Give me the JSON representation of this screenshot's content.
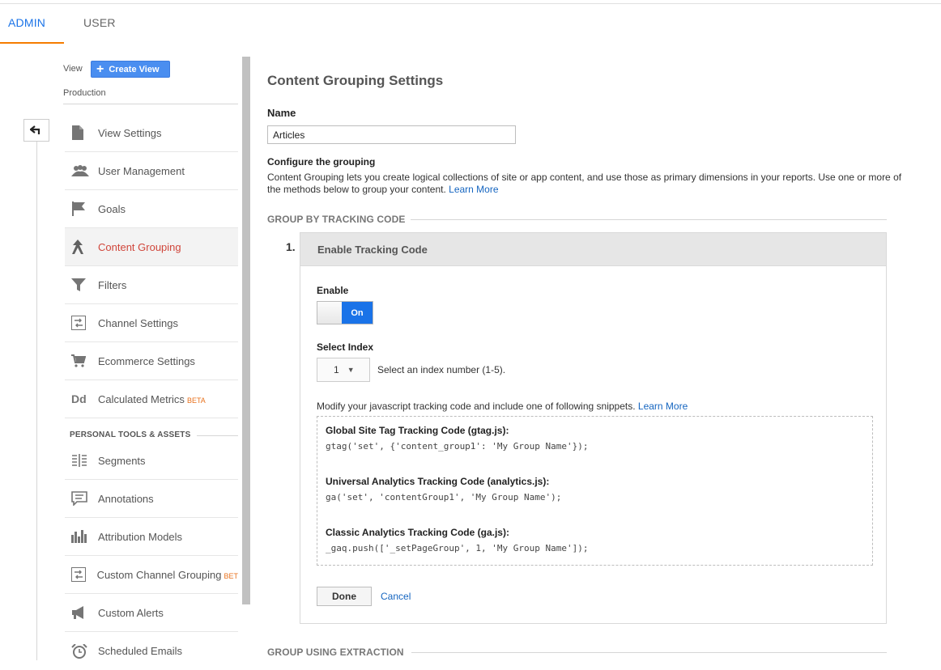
{
  "tabs": [
    {
      "label": "ADMIN",
      "active": true
    },
    {
      "label": "USER",
      "active": false
    }
  ],
  "sidebar": {
    "view_label": "View",
    "create_view_label": "Create View",
    "view_name": "Production",
    "items": [
      {
        "label": "View Settings",
        "icon": "document-icon"
      },
      {
        "label": "User Management",
        "icon": "people-icon"
      },
      {
        "label": "Goals",
        "icon": "flag-icon"
      },
      {
        "label": "Content Grouping",
        "icon": "content-grouping-icon",
        "active": true
      },
      {
        "label": "Filters",
        "icon": "filter-icon"
      },
      {
        "label": "Channel Settings",
        "icon": "channel-icon"
      },
      {
        "label": "Ecommerce Settings",
        "icon": "cart-icon"
      },
      {
        "label": "Calculated Metrics",
        "icon": "dd-icon",
        "badge": "BETA"
      }
    ],
    "section_title": "PERSONAL TOOLS & ASSETS",
    "tools": [
      {
        "label": "Segments",
        "icon": "segments-icon"
      },
      {
        "label": "Annotations",
        "icon": "annotation-icon"
      },
      {
        "label": "Attribution Models",
        "icon": "bar-chart-icon"
      },
      {
        "label": "Custom Channel Grouping",
        "icon": "channel-icon",
        "badge": "BET"
      },
      {
        "label": "Custom Alerts",
        "icon": "megaphone-icon"
      },
      {
        "label": "Scheduled Emails",
        "icon": "alarm-clock-icon"
      }
    ]
  },
  "main": {
    "title": "Content Grouping Settings",
    "name_label": "Name",
    "name_value": "Articles",
    "configure_title": "Configure the grouping",
    "configure_desc": "Content Grouping lets you create logical collections of site or app content, and use those as primary dimensions in your reports. Use one or more of the methods below to group your content.",
    "learn_more": "Learn More",
    "group_tracking_title": "GROUP BY TRACKING CODE",
    "step_number": "1.",
    "panel_title": "Enable Tracking Code",
    "enable_label": "Enable",
    "toggle_state": "On",
    "select_index_label": "Select Index",
    "select_index_value": "1",
    "select_index_hint": "Select an index number (1-5).",
    "modify_text": "Modify your javascript tracking code and include one of following snippets.",
    "modify_link": "Learn More",
    "snippets": [
      {
        "title": "Global Site Tag Tracking Code (gtag.js):",
        "code": "gtag('set', {'content_group1': 'My Group Name'});"
      },
      {
        "title": "Universal Analytics Tracking Code (analytics.js):",
        "code": "ga('set', 'contentGroup1', 'My Group Name');"
      },
      {
        "title": "Classic Analytics Tracking Code (ga.js):",
        "code": "_gaq.push(['_setPageGroup', 1, 'My Group Name']);"
      }
    ],
    "done_label": "Done",
    "cancel_label": "Cancel",
    "group_extraction_title": "GROUP USING EXTRACTION"
  },
  "colors": {
    "accent_blue": "#1a73e8",
    "active_red": "#d0463b",
    "tab_underline": "#f57c00",
    "beta_orange": "#e8711c"
  }
}
